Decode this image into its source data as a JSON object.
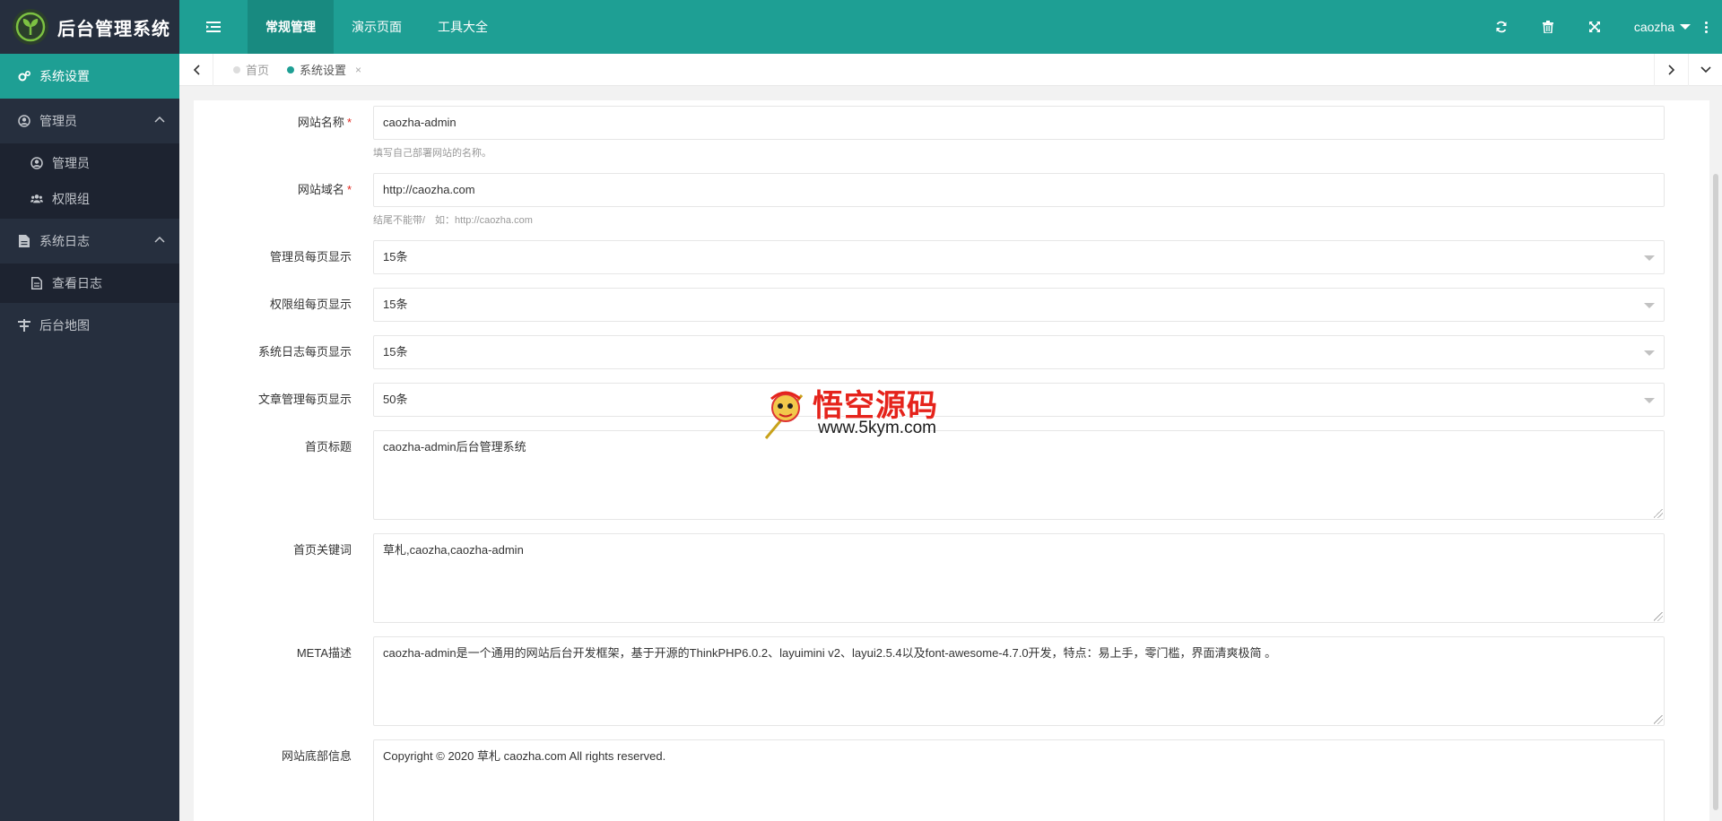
{
  "header": {
    "app_title": "后台管理系统",
    "nav": [
      {
        "label": "常规管理",
        "active": true
      },
      {
        "label": "演示页面",
        "active": false
      },
      {
        "label": "工具大全",
        "active": false
      }
    ],
    "icons": [
      "refresh-icon",
      "trash-icon",
      "fullscreen-icon"
    ],
    "username": "caozha",
    "accent_color": "#1e9f94"
  },
  "sidebar": {
    "items": [
      {
        "label": "系统设置",
        "icon": "gears-icon",
        "active": true
      },
      {
        "label": "管理员",
        "icon": "user-circle-icon",
        "expanded": true,
        "children": [
          {
            "label": "管理员",
            "icon": "user-circle-icon"
          },
          {
            "label": "权限组",
            "icon": "users-icon"
          }
        ]
      },
      {
        "label": "系统日志",
        "icon": "file-icon",
        "expanded": true,
        "children": [
          {
            "label": "查看日志",
            "icon": "file-text-icon"
          }
        ]
      },
      {
        "label": "后台地图",
        "icon": "sitemap-icon"
      }
    ]
  },
  "tabs": {
    "items": [
      {
        "label": "首页",
        "active": false
      },
      {
        "label": "系统设置",
        "active": true,
        "close": "×"
      }
    ]
  },
  "form": {
    "site_name": {
      "label": "网站名称",
      "required": "*",
      "value": "caozha-admin",
      "tip": "填写自己部署网站的名称。"
    },
    "site_domain": {
      "label": "网站域名",
      "required": "*",
      "value": "http://caozha.com",
      "tip": "结尾不能带/　如：http://caozha.com"
    },
    "admin_page": {
      "label": "管理员每页显示",
      "value": "15条"
    },
    "roles_page": {
      "label": "权限组每页显示",
      "value": "15条"
    },
    "log_page": {
      "label": "系统日志每页显示",
      "value": "15条"
    },
    "article_page": {
      "label": "文章管理每页显示",
      "value": "50条"
    },
    "home_title": {
      "label": "首页标题",
      "value": "caozha-admin后台管理系统"
    },
    "home_keywords": {
      "label": "首页关键词",
      "value": "草札,caozha,caozha-admin"
    },
    "meta_desc": {
      "label": "META描述",
      "value": "caozha-admin是一个通用的网站后台开发框架，基于开源的ThinkPHP6.0.2、layuimini v2、layui2.5.4以及font-awesome-4.7.0开发，特点：易上手，零门槛，界面清爽极简 。"
    },
    "footer_info": {
      "label": "网站底部信息",
      "value": "Copyright © 2020 草札 caozha.com All rights reserved."
    }
  },
  "watermark": {
    "title": "悟空源码",
    "url": "www.5kym.com"
  }
}
